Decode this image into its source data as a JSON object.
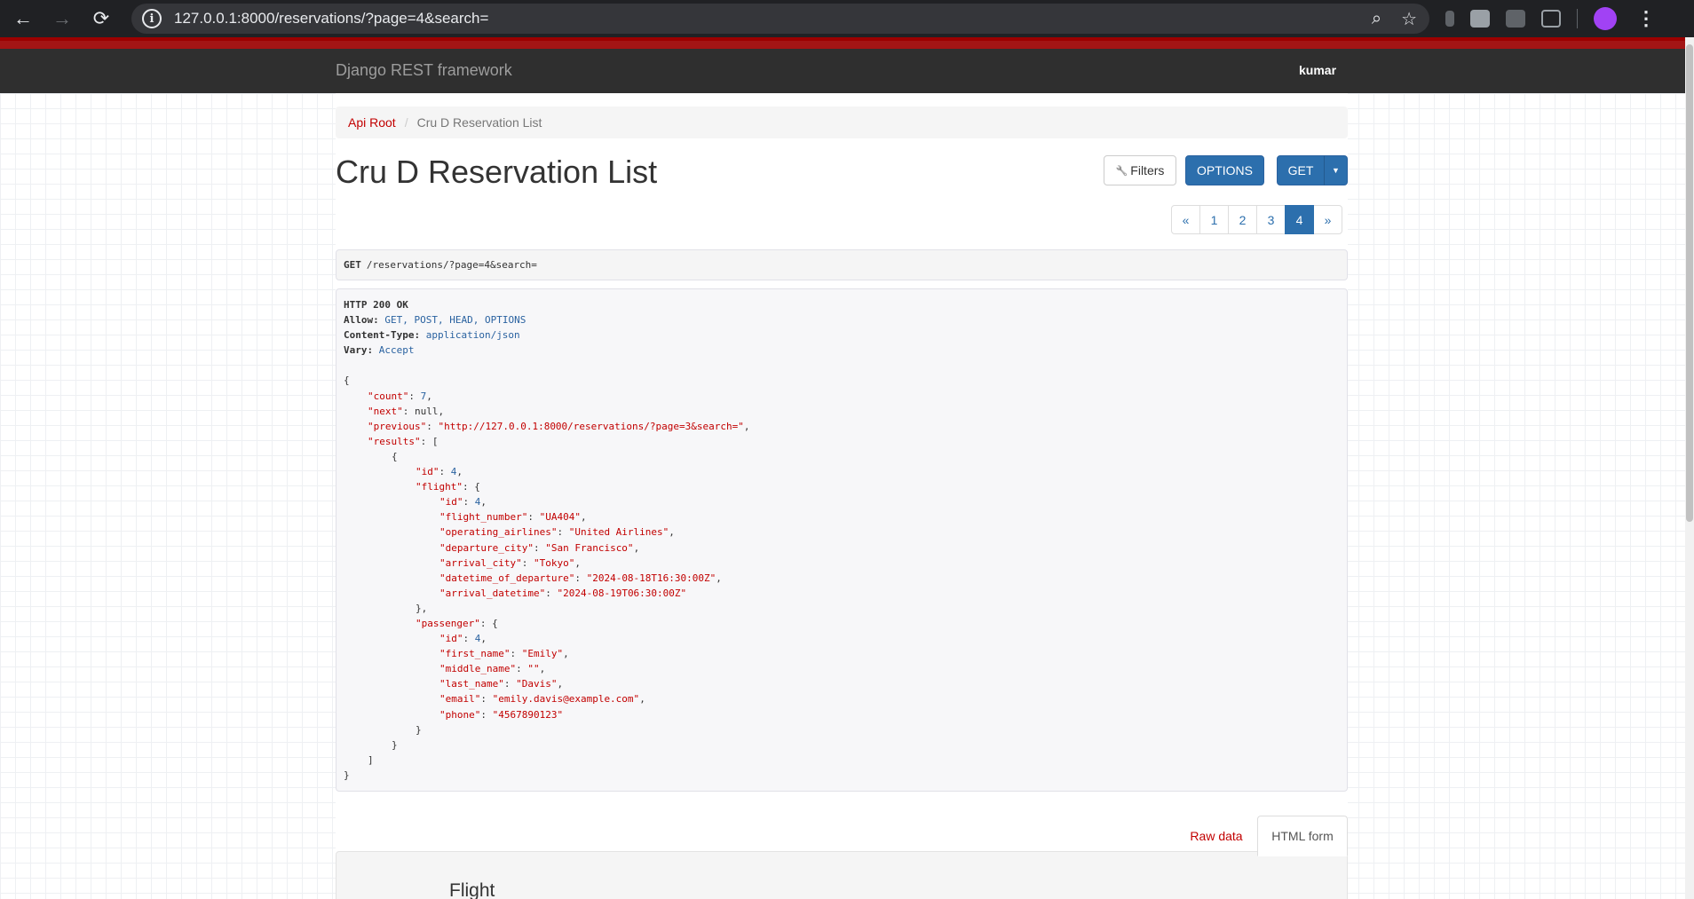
{
  "browser": {
    "url": "127.0.0.1:8000/reservations/?page=4&search=",
    "back_icon": "←",
    "forward_icon": "→",
    "reload_icon": "⟳",
    "info_icon": "i",
    "zoom_icon": "⌕",
    "star_icon": "☆",
    "menu_icon": "⋮"
  },
  "navbar": {
    "brand": "Django REST framework",
    "user": "kumar"
  },
  "breadcrumb": {
    "root": "Api Root",
    "separator": "/",
    "current": "Cru D Reservation List"
  },
  "page": {
    "title": "Cru D Reservation List"
  },
  "buttons": {
    "filters_icon": "🔧",
    "filters": "Filters",
    "options": "OPTIONS",
    "get": "GET",
    "get_caret": "▼"
  },
  "pagination": {
    "prev": "«",
    "pages": [
      "1",
      "2",
      "3",
      "4"
    ],
    "next": "»",
    "active": "4"
  },
  "request": {
    "method": "GET",
    "path": "/reservations/?page=4&search="
  },
  "response": {
    "status": "HTTP 200 OK",
    "headers": [
      {
        "name": "Allow:",
        "value": "GET, POST, HEAD, OPTIONS"
      },
      {
        "name": "Content-Type:",
        "value": "application/json"
      },
      {
        "name": "Vary:",
        "value": "Accept"
      }
    ],
    "body": {
      "count": {
        "key": "\"count\"",
        "value": "7"
      },
      "next": {
        "key": "\"next\"",
        "value": "null"
      },
      "previous": {
        "key": "\"previous\"",
        "value": "\"http://127.0.0.1:8000/reservations/?page=3&search=\""
      },
      "results_key": "\"results\"",
      "result": {
        "id": {
          "key": "\"id\"",
          "value": "4"
        },
        "flight_key": "\"flight\"",
        "flight": {
          "id": {
            "key": "\"id\"",
            "value": "4"
          },
          "flight_number": {
            "key": "\"flight_number\"",
            "value": "\"UA404\""
          },
          "operating_airlines": {
            "key": "\"operating_airlines\"",
            "value": "\"United Airlines\""
          },
          "departure_city": {
            "key": "\"departure_city\"",
            "value": "\"San Francisco\""
          },
          "arrival_city": {
            "key": "\"arrival_city\"",
            "value": "\"Tokyo\""
          },
          "datetime_of_departure": {
            "key": "\"datetime_of_departure\"",
            "value": "\"2024-08-18T16:30:00Z\""
          },
          "arrival_datetime": {
            "key": "\"arrival_datetime\"",
            "value": "\"2024-08-19T06:30:00Z\""
          }
        },
        "passenger_key": "\"passenger\"",
        "passenger": {
          "id": {
            "key": "\"id\"",
            "value": "4"
          },
          "first_name": {
            "key": "\"first_name\"",
            "value": "\"Emily\""
          },
          "middle_name": {
            "key": "\"middle_name\"",
            "value": "\"\""
          },
          "last_name": {
            "key": "\"last_name\"",
            "value": "\"Davis\""
          },
          "email": {
            "key": "\"email\"",
            "value": "\"emily.davis@example.com\""
          },
          "phone": {
            "key": "\"phone\"",
            "value": "\"4567890123\""
          }
        }
      }
    }
  },
  "tabs": {
    "raw": "Raw data",
    "html": "HTML form"
  },
  "form": {
    "legend": "Flight"
  }
}
